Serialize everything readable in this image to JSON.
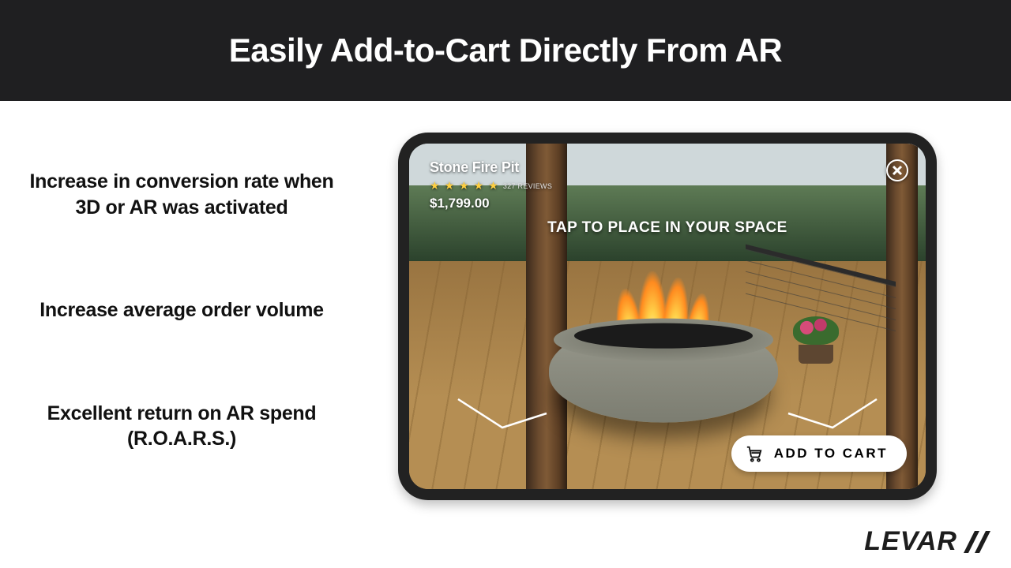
{
  "header": {
    "title": "Easily Add-to-Cart Directly From AR"
  },
  "benefits": [
    "Increase in conversion rate when 3D or AR was activated",
    "Increase average order volume",
    "Excellent return on AR spend (R.O.A.R.S.)"
  ],
  "ar_view": {
    "product_name": "Stone Fire Pit",
    "reviews_count": "327 REVIEWS",
    "star_rating": 5,
    "price": "$1,799.00",
    "tap_hint": "TAP TO PLACE IN YOUR SPACE",
    "add_to_cart_label": "ADD TO CART"
  },
  "brand": {
    "name": "LEVAR"
  }
}
